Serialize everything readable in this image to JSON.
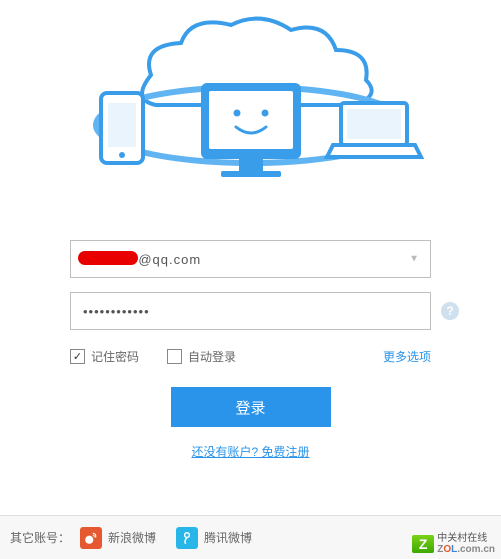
{
  "form": {
    "username_value": "            @qq.com",
    "password_value": "••••••••••••",
    "remember_label": "记住密码",
    "autologin_label": "自动登录",
    "remember_checked": true,
    "autologin_checked": false,
    "more_options_label": "更多选项",
    "login_button_label": "登录",
    "register_link_label": "还没有账户? 免费注册"
  },
  "footer": {
    "other_accounts_label": "其它账号：",
    "weibo_label": "新浪微博",
    "tencent_label": "腾讯微博"
  },
  "watermark": {
    "line1": "中关村在线",
    "line2_html": "Z<span class='o'>O</span><span class='l'>L</span>.com.cn"
  }
}
